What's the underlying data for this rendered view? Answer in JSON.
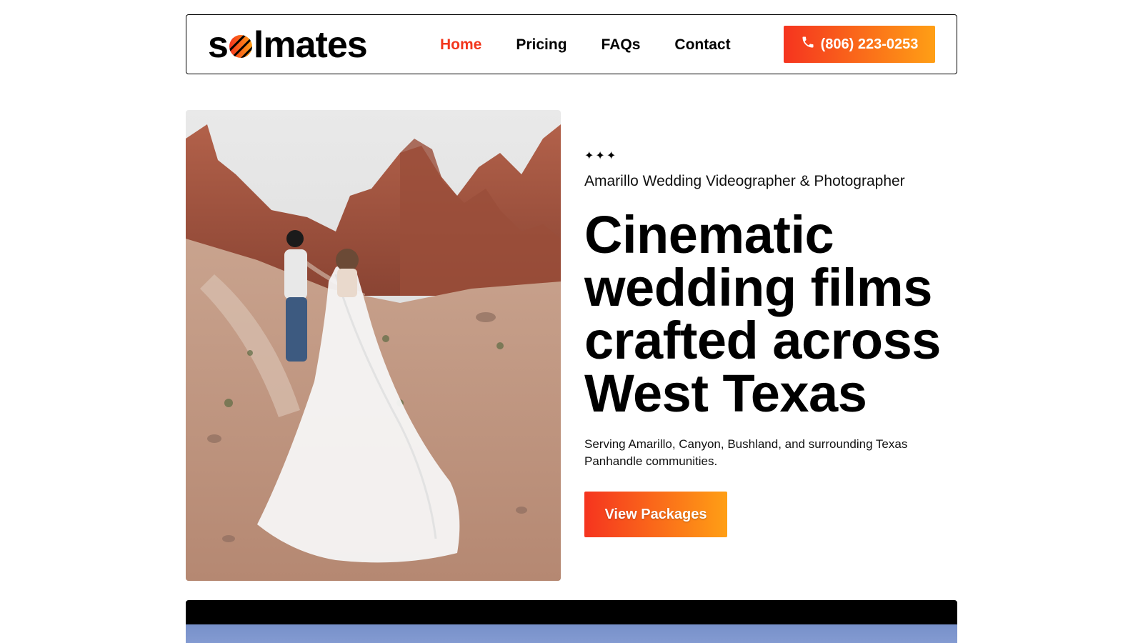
{
  "header": {
    "logo": {
      "prefix": "s",
      "suffix": "lmates"
    },
    "nav": [
      {
        "label": "Home",
        "active": true
      },
      {
        "label": "Pricing",
        "active": false
      },
      {
        "label": "FAQs",
        "active": false
      },
      {
        "label": "Contact",
        "active": false
      }
    ],
    "phone": "(806) 223-0253"
  },
  "hero": {
    "sparkles": "✦✦✦",
    "subtitle": "Amarillo Wedding Videographer & Photographer",
    "headline_lines": [
      "Cinematic",
      "wedding films",
      "crafted across",
      "West Texas"
    ],
    "description": "Serving Amarillo, Canyon, Bushland, and surrounding Texas Panhandle communities.",
    "cta_label": "View Packages"
  },
  "colors": {
    "accent_red": "#f2361c",
    "gradient_start": "#f5341f",
    "gradient_end": "#ff9f15"
  },
  "icons": {
    "phone": "phone-icon",
    "logo_mark": "sun-stripes-icon"
  }
}
